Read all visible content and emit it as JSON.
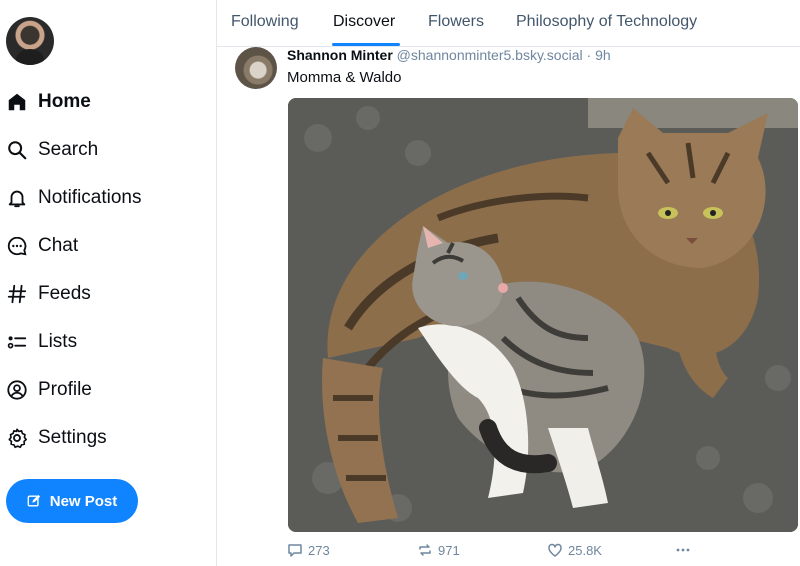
{
  "sidebar": {
    "items": [
      {
        "label": "Home",
        "icon": "home-icon"
      },
      {
        "label": "Search",
        "icon": "search-icon"
      },
      {
        "label": "Notifications",
        "icon": "bell-icon"
      },
      {
        "label": "Chat",
        "icon": "chat-icon"
      },
      {
        "label": "Feeds",
        "icon": "hash-icon"
      },
      {
        "label": "Lists",
        "icon": "list-icon"
      },
      {
        "label": "Profile",
        "icon": "user-circle-icon"
      },
      {
        "label": "Settings",
        "icon": "gear-icon"
      }
    ],
    "new_post_label": "New Post"
  },
  "tabs": [
    {
      "label": "Following"
    },
    {
      "label": "Discover"
    },
    {
      "label": "Flowers"
    },
    {
      "label": "Philosophy of Technology"
    }
  ],
  "post": {
    "author_name": "Shannon Minter",
    "author_handle": "@shannonminter5.bsky.social",
    "separator": "·",
    "time": "9h",
    "text": "Momma & Waldo",
    "replies": "273",
    "reposts": "971",
    "likes": "25.8K"
  },
  "colors": {
    "accent": "#1083fe",
    "muted": "#6f869f",
    "text": "#0b0f14"
  }
}
